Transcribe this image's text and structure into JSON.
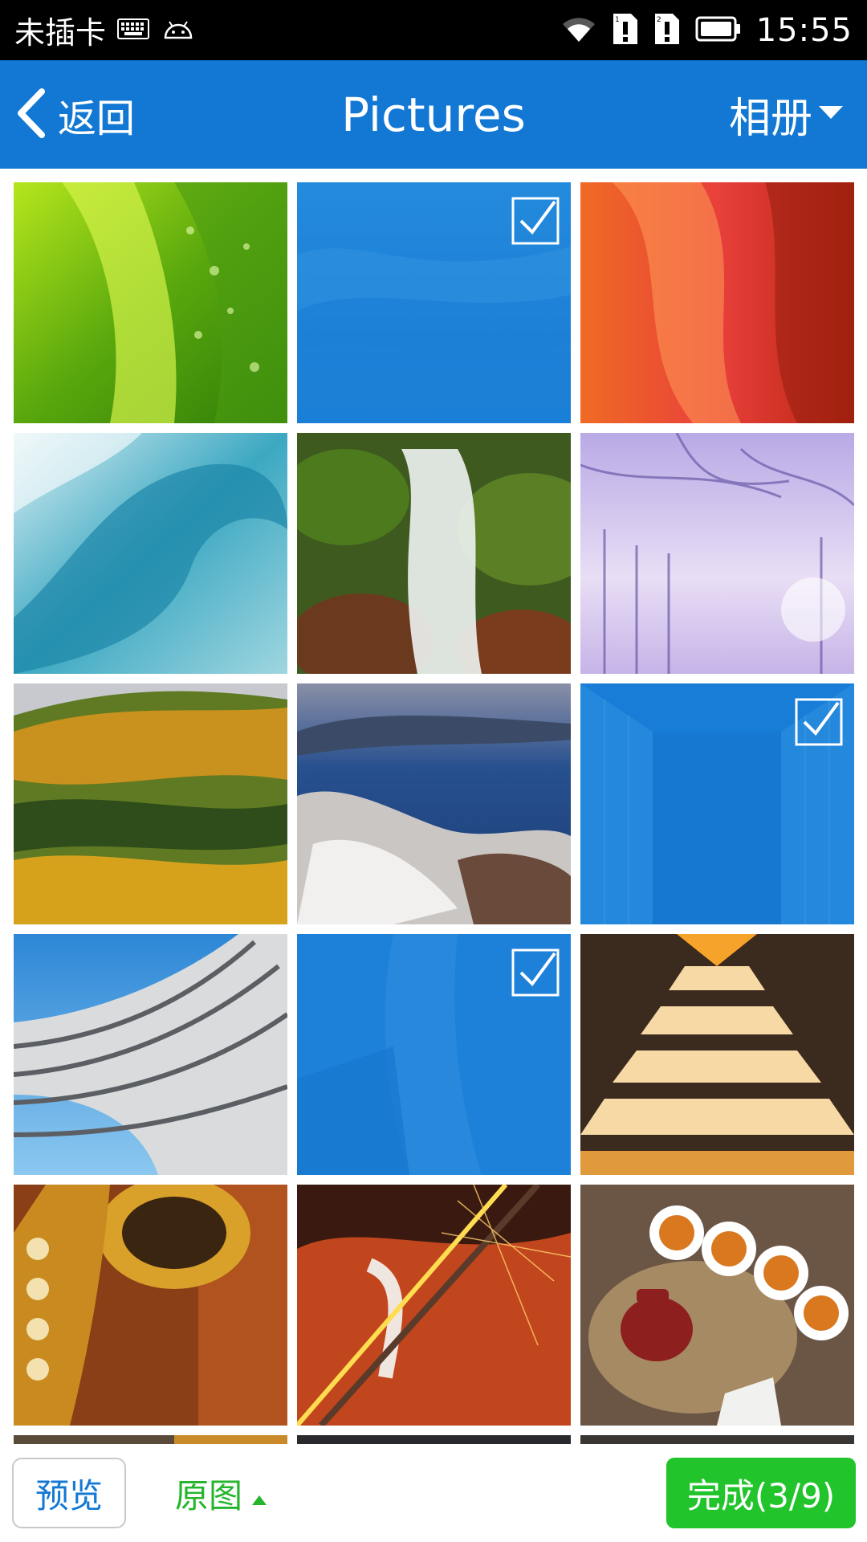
{
  "status_bar": {
    "carrier": "未插卡",
    "time": "15:55",
    "icons": [
      "keyboard-icon",
      "android-icon",
      "wifi-icon",
      "sim1-alert-icon",
      "sim2-alert-icon",
      "battery-icon"
    ]
  },
  "header": {
    "back_label": "返回",
    "title": "Pictures",
    "album_label": "相册"
  },
  "grid": {
    "images": [
      {
        "subject": "green leaf with water drops",
        "selected": false
      },
      {
        "subject": "blue abstract waves",
        "selected": true
      },
      {
        "subject": "red sandstone canyon",
        "selected": false
      },
      {
        "subject": "ocean wave",
        "selected": false
      },
      {
        "subject": "waterfall over mossy rocks",
        "selected": false
      },
      {
        "subject": "snowy purple forest",
        "selected": false
      },
      {
        "subject": "autumn forest hills",
        "selected": false
      },
      {
        "subject": "lake with driftwood",
        "selected": false
      },
      {
        "subject": "blue glass corridor",
        "selected": true
      },
      {
        "subject": "curved modern building",
        "selected": false
      },
      {
        "subject": "blue architecture",
        "selected": true
      },
      {
        "subject": "orange staircase",
        "selected": false
      },
      {
        "subject": "saxophone",
        "selected": false
      },
      {
        "subject": "violin with sparks",
        "selected": false
      },
      {
        "subject": "tea set",
        "selected": false
      }
    ]
  },
  "bottom_bar": {
    "preview_label": "预览",
    "original_label": "原图",
    "done_label": "完成(3/9)"
  },
  "colors": {
    "primary": "#1278d4",
    "done_green": "#22c42c",
    "original_green": "#25b52c",
    "status_bar": "#000000"
  }
}
